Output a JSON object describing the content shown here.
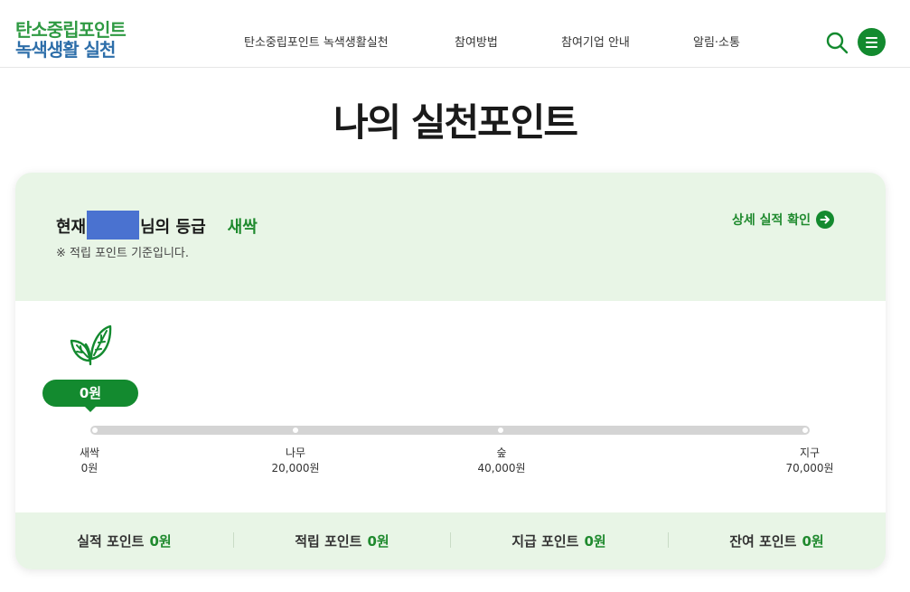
{
  "header": {
    "logo_line1": "탄소중립포인트",
    "logo_line2": "녹색생활 실천",
    "nav": [
      "탄소중립포인트 녹색생활실천",
      "참여방법",
      "참여기업 안내",
      "알림·소통"
    ],
    "colors": {
      "accent": "#138a2f",
      "logo_green": "#2f9a43",
      "logo_blue": "#2d6ea9"
    }
  },
  "page": {
    "title": "나의 실천포인트"
  },
  "grade": {
    "prefix": "현재",
    "suffix": "님의 등급",
    "value": "새싹",
    "note": "※ 적립 포인트 기준입니다.",
    "detail_link": "상세 실적 확인"
  },
  "progress": {
    "current_label": "0원",
    "current_fraction": 0,
    "icon": "sprout-icon",
    "stages": [
      {
        "name": "새싹",
        "points": "0원"
      },
      {
        "name": "나무",
        "points": "20,000원"
      },
      {
        "name": "숲",
        "points": "40,000원"
      },
      {
        "name": "지구",
        "points": "70,000원"
      }
    ]
  },
  "summary": [
    {
      "label": "실적 포인트",
      "value": "0원"
    },
    {
      "label": "적립 포인트",
      "value": "0원"
    },
    {
      "label": "지급 포인트",
      "value": "0원"
    },
    {
      "label": "잔여 포인트",
      "value": "0원"
    }
  ]
}
